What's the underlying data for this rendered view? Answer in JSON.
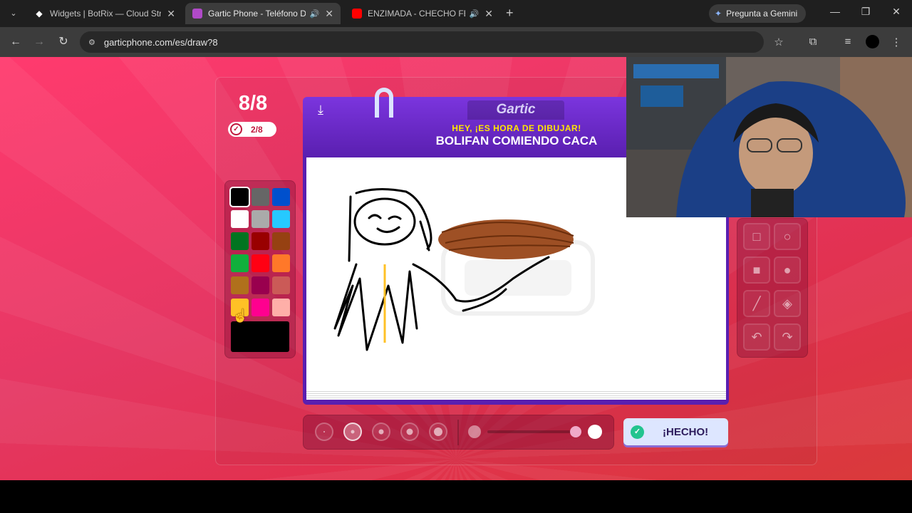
{
  "browser": {
    "tabs": [
      {
        "title": "Widgets | BotRix — Cloud Stream",
        "favicon_color": "#ffffff",
        "audio": false
      },
      {
        "title": "Gartic Phone - Teléfono De",
        "favicon_color": "#b04ac8",
        "audio": true
      },
      {
        "title": "ENZIMADA - CHECHO FEAT",
        "favicon_color": "#ff0000",
        "audio": true
      }
    ],
    "new_tab": "+",
    "gemini_label": "Pregunta a Gemini",
    "url": "garticphone.com/es/draw?8"
  },
  "game": {
    "round": "8/8",
    "done_count": "2/8",
    "brand": "Gartic",
    "subline": "HEY, ¡ES HORA DE DIBUJAR!",
    "prompt": "BOLIFAN COMIENDO CACA",
    "done_button": "¡HECHO!",
    "current_color": "#000000",
    "palette": [
      "#000000",
      "#666666",
      "#0050cd",
      "#ffffff",
      "#aaaaaa",
      "#26c9ff",
      "#017420",
      "#990000",
      "#964112",
      "#11b03c",
      "#ff0013",
      "#ff7829",
      "#b0701c",
      "#99004e",
      "#cb5a57",
      "#ffc126",
      "#ff008f",
      "#feafa8"
    ],
    "selected_color_index": 0,
    "tools": [
      "square-outline",
      "circle-outline",
      "square-filled",
      "circle-filled",
      "line",
      "bucket",
      "undo",
      "redo"
    ],
    "brush_sizes": 5,
    "selected_brush_index": 1,
    "opacity": 1.0
  }
}
